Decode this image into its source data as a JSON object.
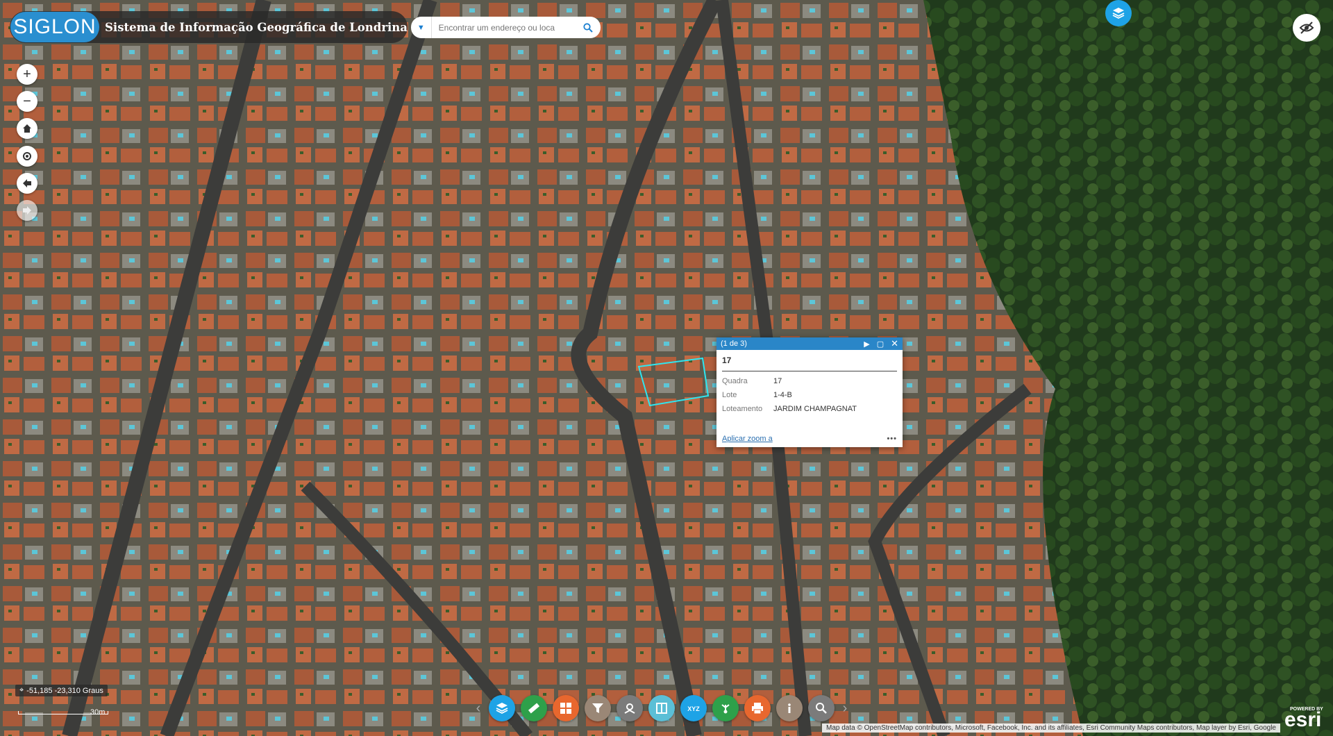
{
  "header": {
    "logo_text": "SIGLON",
    "title": "Sistema de Informação Geográfica de Londrina"
  },
  "search": {
    "placeholder": "Encontrar um endereço ou loca"
  },
  "popup": {
    "pager": "(1 de 3)",
    "title": "17",
    "fields": [
      {
        "key": "Quadra",
        "value": "17"
      },
      {
        "key": "Lote",
        "value": "1-4-B"
      },
      {
        "key": "Loteamento",
        "value": "JARDIM CHAMPAGNAT"
      }
    ],
    "zoom_link": "Aplicar zoom a",
    "more": "•••"
  },
  "coordinates": "-51,185 -23,310 Graus",
  "scale_label": "30m",
  "attribution": "Map data © OpenStreetMap contributors, Microsoft, Facebook, Inc. and its affiliates, Esri Community Maps contributors, Map layer by Esri, Google",
  "esri": {
    "powered_by": "POWERED BY",
    "name": "esri"
  },
  "toolbar": [
    {
      "icon": "layers-icon",
      "color": "#1ea3e6"
    },
    {
      "icon": "measure-ruler-icon",
      "color": "#2ea04a"
    },
    {
      "icon": "grid-icon",
      "color": "#e8672e"
    },
    {
      "icon": "filter-icon",
      "color": "#9a8776"
    },
    {
      "icon": "location-search-icon",
      "color": "#7b7b7b"
    },
    {
      "icon": "swipe-icon",
      "color": "#5bbfd6"
    },
    {
      "icon": "xyz-icon",
      "color": "#1ea3e6"
    },
    {
      "icon": "share-icon",
      "color": "#2ea04a"
    },
    {
      "icon": "print-icon",
      "color": "#e8672e"
    },
    {
      "icon": "info-icon",
      "color": "#9a8776"
    },
    {
      "icon": "zoom-search-icon",
      "color": "#7b7b7b"
    }
  ],
  "colors": {
    "accent": "#2a86c8",
    "selection": "#2ee6f0"
  }
}
